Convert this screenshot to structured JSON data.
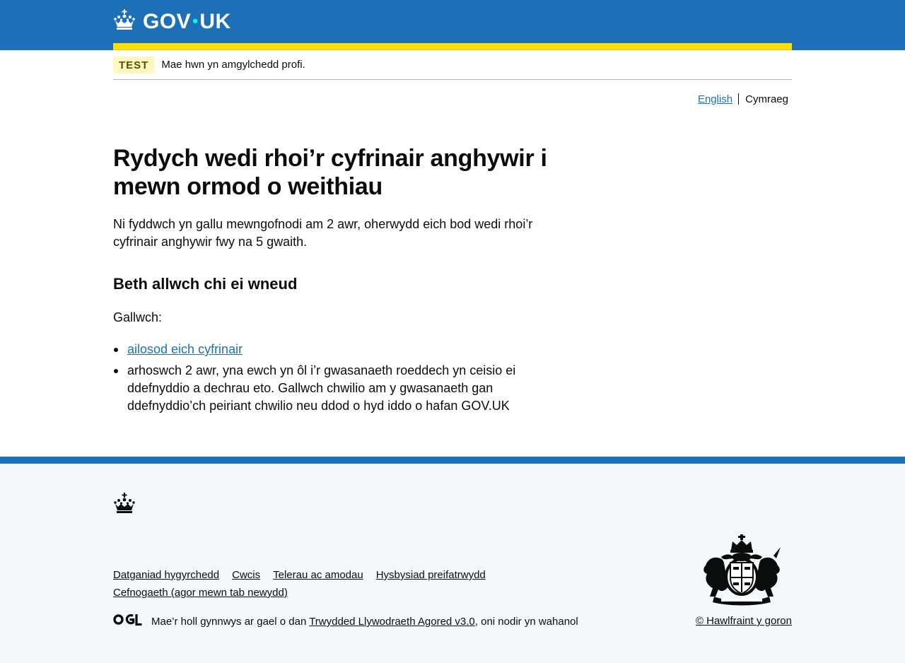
{
  "header": {
    "logo_text_left": "GOV",
    "logo_dot": "•",
    "logo_text_right": "UK",
    "logo_icon": "crown-icon",
    "colors": {
      "header_bg": "#1d70b8",
      "stripe": "#ffdd00",
      "dot": "#00ffe0"
    }
  },
  "phase_banner": {
    "tag": "TEST",
    "text": "Mae hwn yn amgylchedd profi."
  },
  "language_toggle": {
    "english_label": "English",
    "welsh_label": "Cymraeg"
  },
  "main": {
    "heading": "Rydych wedi rhoi’r cyfrinair anghywir i mewn ormod o weithiau",
    "intro": "Ni fyddwch yn gallu mewngofnodi am 2 awr, oherwydd eich bod wedi rhoi’r cyfrinair anghywir fwy na 5 gwaith.",
    "subheading": "Beth allwch chi ei wneud",
    "lead": "Gallwch:",
    "bullets": {
      "reset_link": "ailosod eich cyfrinair",
      "wait_text": "arhoswch 2 awr, yna ewch yn ôl i’r gwasanaeth roeddech yn ceisio ei ddefnyddio a dechrau eto. Gallwch chwilio am y gwasanaeth gan ddefnyddio’ch peiriant chwilio neu ddod o hyd iddo o hafan GOV.UK"
    },
    "link_color": "#1d70b8"
  },
  "footer": {
    "links": [
      "Datganiad hygyrchedd",
      "Cwcis",
      "Telerau ac amodau",
      "Hysbysiad preifatrwydd",
      "Cefnogaeth (agor mewn tab newydd)"
    ],
    "ogl_logo": "OGL",
    "licence_prefix": "Mae’r holl gynnwys ar gael o dan ",
    "licence_link": "Trwydded Llywodraeth Agored v3.0",
    "licence_suffix": ", oni nodir yn wahanol",
    "copyright": "© Hawlfraint y goron",
    "crest_icon": "royal-coat-of-arms-icon",
    "colors": {
      "bg": "#f4f8fb",
      "top_border": "#1d70b8"
    }
  }
}
